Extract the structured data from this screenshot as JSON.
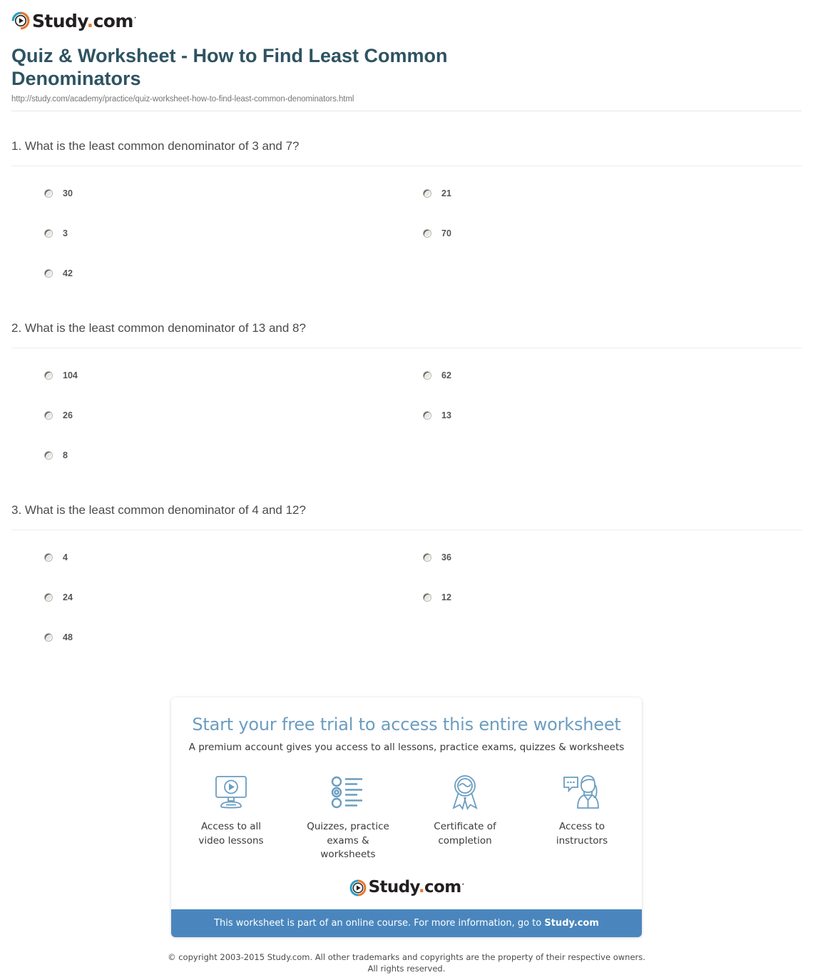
{
  "brand": {
    "name_main": "Study",
    "name_dot": ".",
    "name_tld": "com",
    "trademark": "·",
    "logo_blue": "#2a9fc4",
    "logo_orange": "#e8762c",
    "logo_icon": "play-circle-icon"
  },
  "header": {
    "title": "Quiz & Worksheet - How to Find Least Common Denominators",
    "url": "http://study.com/academy/practice/quiz-worksheet-how-to-find-least-common-denominators.html",
    "title_color": "#2e5361"
  },
  "questions": [
    {
      "text": "1. What is the least common denominator of 3 and 7?",
      "options_left": [
        "30",
        "3",
        "42"
      ],
      "options_right": [
        "21",
        "70"
      ]
    },
    {
      "text": "2. What is the least common denominator of 13 and 8?",
      "options_left": [
        "104",
        "26",
        "8"
      ],
      "options_right": [
        "62",
        "13"
      ]
    },
    {
      "text": "3. What is the least common denominator of 4 and 12?",
      "options_left": [
        "4",
        "24",
        "48"
      ],
      "options_right": [
        "36",
        "12"
      ]
    }
  ],
  "promo": {
    "heading": "Start your free trial to access this entire worksheet",
    "subheading": "A premium account gives you access to all lessons, practice exams, quizzes & worksheets",
    "heading_color": "#6b9dc0",
    "bar_color": "#4a86bd",
    "features": [
      {
        "icon": "monitor-play-icon",
        "label": "Access to all video lessons"
      },
      {
        "icon": "quiz-list-icon",
        "label": "Quizzes, practice exams & worksheets"
      },
      {
        "icon": "award-ribbon-icon",
        "label": "Certificate of completion"
      },
      {
        "icon": "instructor-chat-icon",
        "label": "Access to instructors"
      }
    ],
    "bar_text_prefix": "This worksheet is part of an online course. For more information, go to ",
    "bar_link_text": "Study.com"
  },
  "footer": {
    "copyright_line1": "© copyright 2003-2015 Study.com. All other trademarks and copyrights are the property of their respective owners.",
    "copyright_line2": "All rights reserved."
  }
}
